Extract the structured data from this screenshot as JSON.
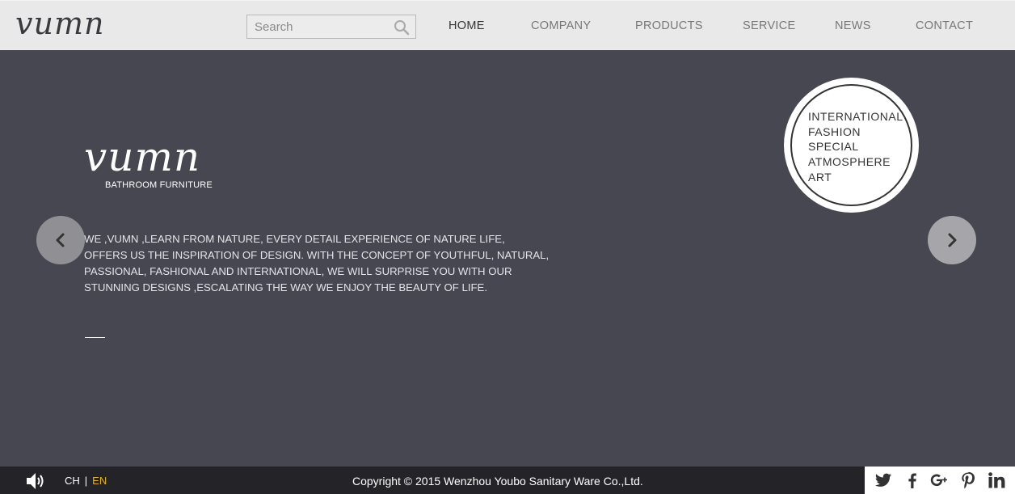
{
  "header": {
    "logo_text": "vumn",
    "search": {
      "placeholder": "Search"
    },
    "nav": [
      {
        "label": "HOME",
        "active": true
      },
      {
        "label": "COMPANY"
      },
      {
        "label": "PRODUCTS"
      },
      {
        "label": "SERVICE"
      },
      {
        "label": "NEWS"
      },
      {
        "label": "CONTACT"
      }
    ]
  },
  "hero": {
    "logo_text": "vumn",
    "subtitle": "BATHROOM  FURNITURE",
    "description_lines": [
      "WE ,VUMN ,LEARN FROM NATURE, EVERY DETAIL EXPERIENCE OF NATURE LIFE,",
      "OFFERS US THE INSPIRATION  OF DESIGN. WITH THE CONCEPT OF YOUTHFUL, NATURAL,",
      "PASSIONAL, FASHIONAL AND INTERNATIONAL, WE  WILL SURPRISE YOU WITH OUR",
      "STUNNING DESIGNS ,ESCALATING THE WAY WE ENJOY THE BEAUTY OF LIFE."
    ],
    "badge_lines": [
      "INTERNATIONAL",
      "FASHION",
      "SPECIAL",
      "ATMOSPHERE",
      "ART"
    ],
    "prev_icon": "chevron-left-icon",
    "next_icon": "chevron-right-icon"
  },
  "footer": {
    "sound_icon": "speaker-icon",
    "lang": {
      "ch": "CH",
      "separator": "|",
      "en": "EN",
      "active_color": "#e2b22b"
    },
    "copyright": "Copyright © 2015 Wenzhou Youbo Sanitary Ware Co.,Ltd.",
    "social": [
      "twitter-icon",
      "facebook-icon",
      "google-plus-icon",
      "pinterest-icon",
      "linkedin-icon"
    ]
  },
  "colors": {
    "header_bg": "#e9e9ea",
    "hero_bg": "#474751",
    "footer_bg": "#242428"
  }
}
